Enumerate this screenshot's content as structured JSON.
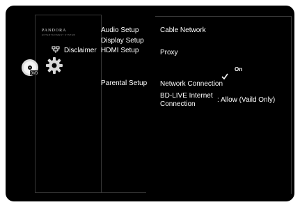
{
  "brand": {
    "name": "PANDORA",
    "tagline": "ENTERTAINMENT SYSTEM"
  },
  "left_panel": {
    "disclaimer_label": "Disclaimer",
    "icons": [
      "disc-icon",
      "gear-icon",
      "network-icon"
    ]
  },
  "menu": {
    "items": [
      {
        "label": "Audio Setup"
      },
      {
        "label": "Display Setup"
      },
      {
        "label": "HDMI Setup"
      },
      {
        "label": "Parental Setup"
      }
    ]
  },
  "settings": {
    "cable_network": "Cable Network",
    "proxy": "Proxy",
    "on_option": "On",
    "network_connection": "Network Connection",
    "bd_live_label": "BD-LIVE Internet Connection",
    "bd_live_value": ": Allow (Vaild Only)"
  },
  "colors": {
    "background": "#000000",
    "text": "#ffffff",
    "page": "#ffffff"
  }
}
